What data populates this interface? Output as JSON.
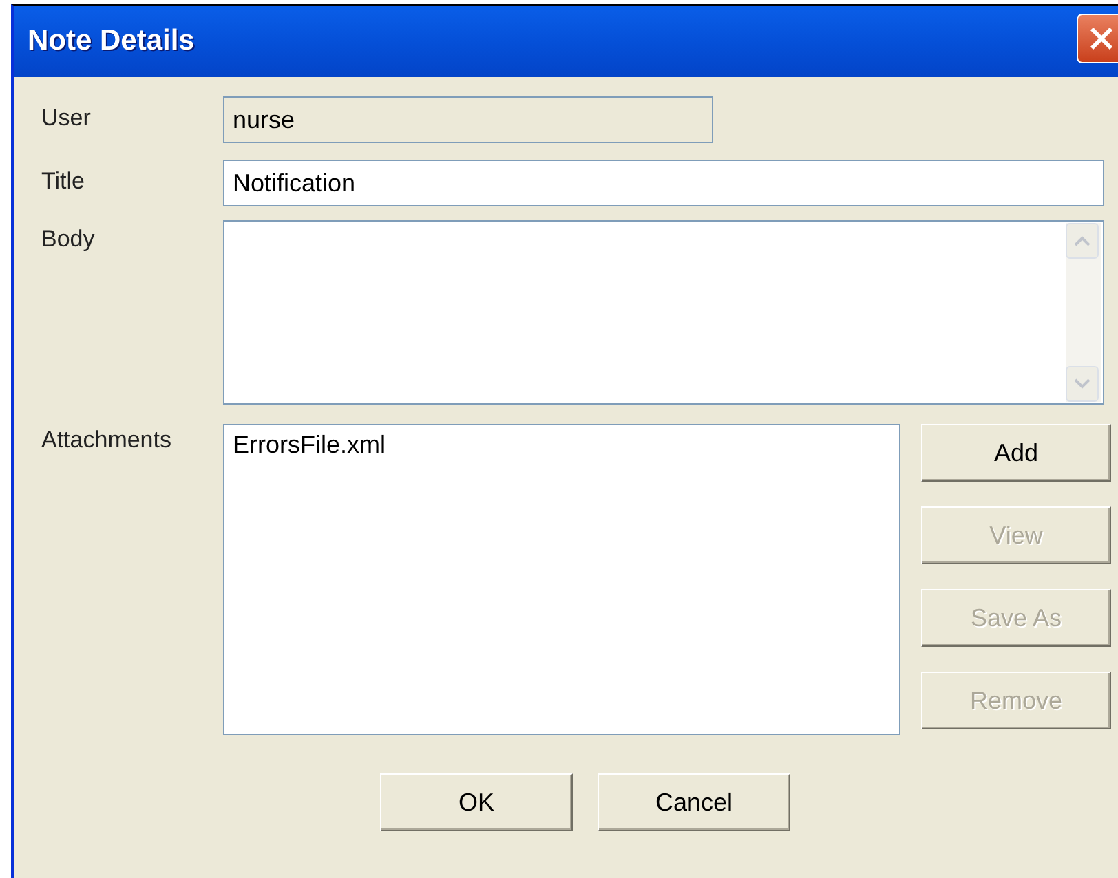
{
  "window": {
    "title": "Note Details"
  },
  "fields": [
    {
      "kind": "readonly",
      "label": "User",
      "value": "nurse"
    },
    {
      "kind": "text",
      "label": "Title",
      "value": "Notification"
    },
    {
      "kind": "textarea",
      "label": "Body"
    }
  ],
  "attachments": {
    "label": "Attachments",
    "items": [
      {
        "name": "ErrorsFile.xml",
        "selected": false
      }
    ],
    "buttons": [
      {
        "label": "Add",
        "disabled": false
      },
      {
        "label": "View",
        "disabled": true
      },
      {
        "label": "Save As",
        "disabled": true
      },
      {
        "label": "Remove",
        "disabled": true
      }
    ]
  },
  "footer_buttons": [
    {
      "label": "OK"
    },
    {
      "label": "Cancel"
    }
  ]
}
